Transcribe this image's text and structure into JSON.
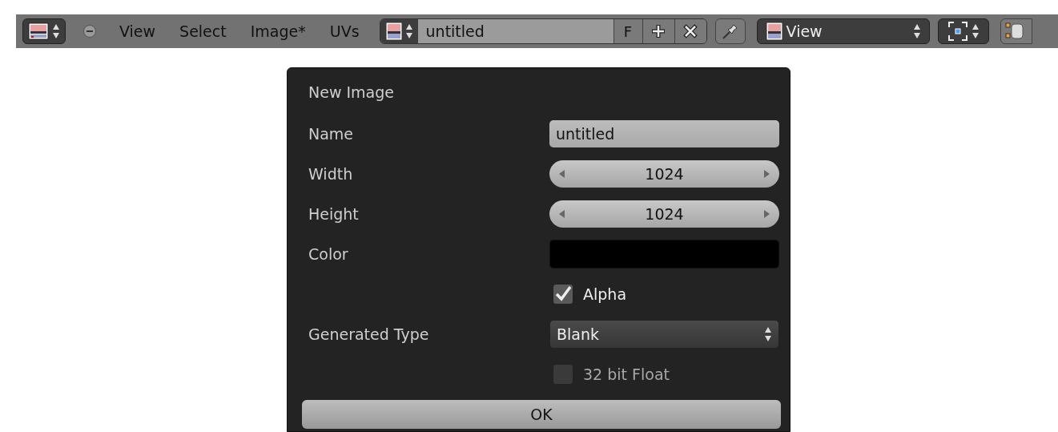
{
  "header": {
    "menus": [
      "View",
      "Select",
      "Image*",
      "UVs"
    ],
    "image_name": "untitled",
    "fake_user": "F",
    "view_mode": "View"
  },
  "dialog": {
    "title": "New Image",
    "rows": [
      {
        "kind": "text",
        "label": "Name",
        "value": "untitled"
      },
      {
        "kind": "number",
        "label": "Width",
        "value": "1024"
      },
      {
        "kind": "number",
        "label": "Height",
        "value": "1024"
      },
      {
        "kind": "color",
        "label": "Color",
        "color": "#000000"
      },
      {
        "kind": "checkbox",
        "label": "Alpha",
        "checked": true
      },
      {
        "kind": "enum",
        "label": "Generated Type",
        "value": "Blank"
      },
      {
        "kind": "checkbox",
        "label": "32 bit Float",
        "checked": false
      }
    ],
    "ok": "OK"
  }
}
